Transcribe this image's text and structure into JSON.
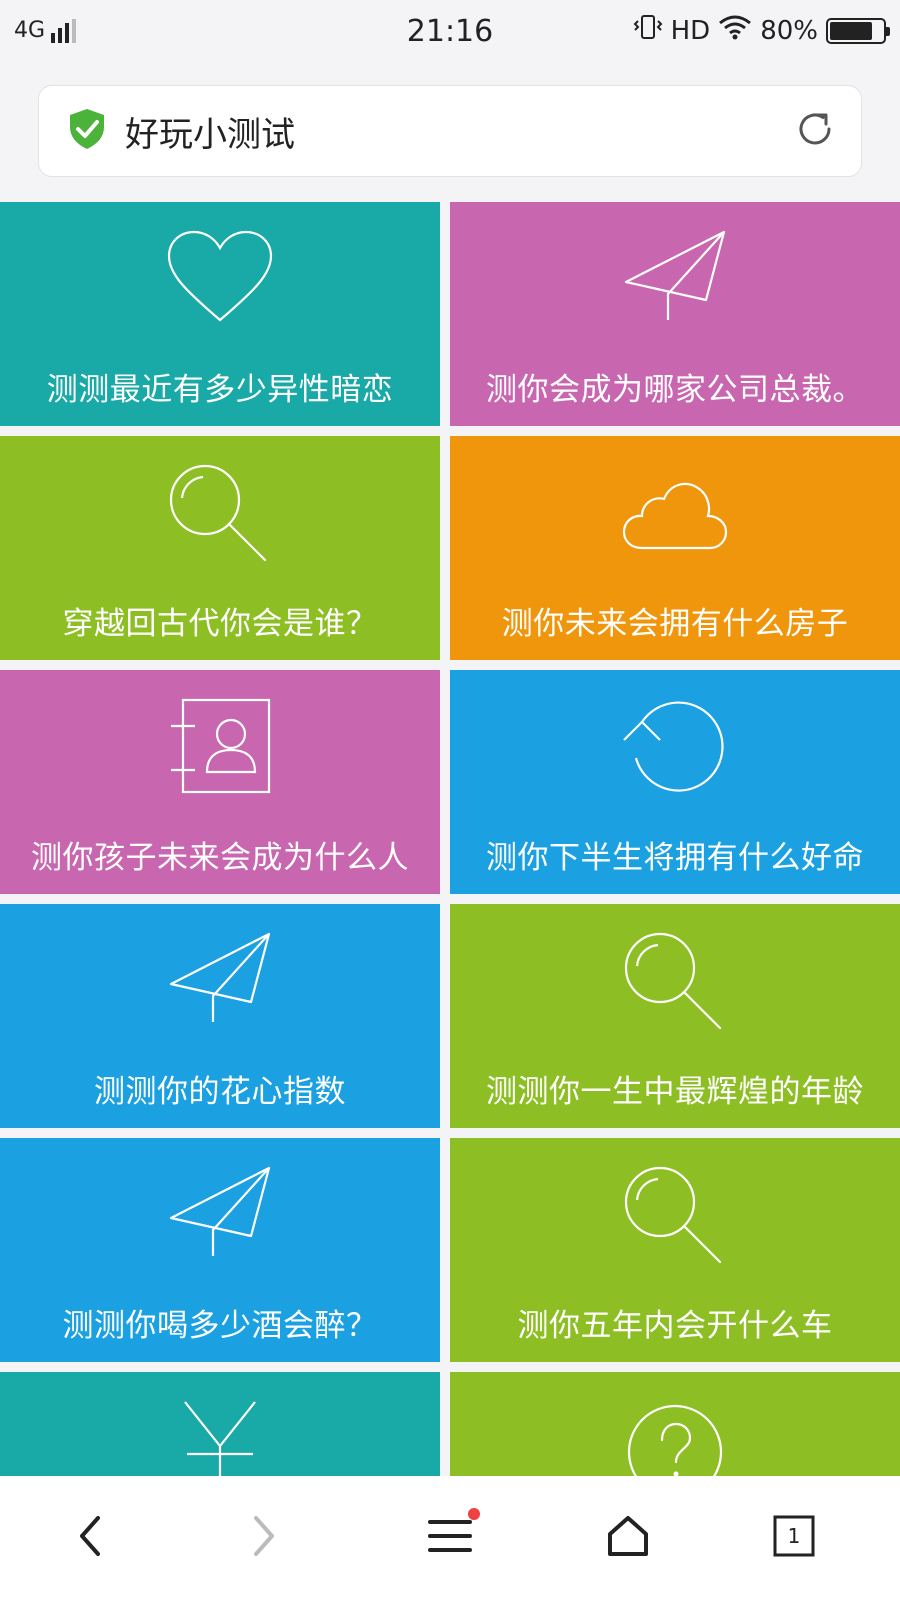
{
  "status_bar": {
    "network": "4G",
    "time": "21:16",
    "hd": "HD",
    "battery_text": "80%",
    "battery_level": 0.8
  },
  "address_bar": {
    "title": "好玩小测试",
    "secure_icon": "shield-check-icon",
    "refresh_icon": "refresh-icon",
    "secure_color": "#4cb33a"
  },
  "tiles": [
    {
      "label": "测测最近有多少异性暗恋",
      "icon": "heart-icon",
      "color": "#19aaa8"
    },
    {
      "label": "测你会成为哪家公司总裁。",
      "icon": "paper-plane-icon",
      "color": "#c867b0"
    },
    {
      "label": "穿越回古代你会是谁？",
      "icon": "magnifier-icon",
      "color": "#8dbf25"
    },
    {
      "label": "测你未来会拥有什么房子",
      "icon": "cloud-icon",
      "color": "#f0960d"
    },
    {
      "label": "测你孩子未来会成为什么人",
      "icon": "contact-book-icon",
      "color": "#c867b0"
    },
    {
      "label": "测你下半生将拥有什么好命",
      "icon": "undo-circle-icon",
      "color": "#1ba0e2"
    },
    {
      "label": "测测你的花心指数",
      "icon": "paper-plane-icon",
      "color": "#1ba0e2"
    },
    {
      "label": "测测你一生中最辉煌的年龄",
      "icon": "magnifier-icon",
      "color": "#8dbf25"
    },
    {
      "label": "测测你喝多少酒会醉？",
      "icon": "paper-plane-icon",
      "color": "#1ba0e2"
    },
    {
      "label": "测你五年内会开什么车",
      "icon": "magnifier-icon",
      "color": "#8dbf25"
    },
    {
      "label": "",
      "icon": "yen-icon",
      "color": "#19aaa8"
    },
    {
      "label": "",
      "icon": "question-circle-icon",
      "color": "#8dbf25"
    }
  ],
  "bottom_nav": {
    "back_icon": "chevron-left-icon",
    "forward_icon": "chevron-right-icon",
    "menu_icon": "menu-icon",
    "home_icon": "home-icon",
    "tabs_icon": "tabs-icon",
    "tabs_count": "1"
  }
}
